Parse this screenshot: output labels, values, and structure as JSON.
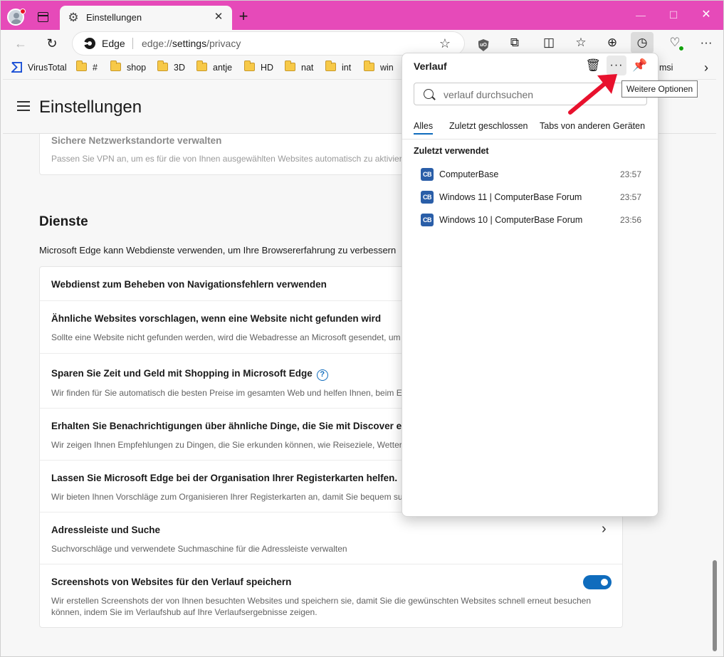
{
  "window": {
    "tab_title": "Einstellungen",
    "close_tab_glyph": "✕",
    "new_tab_glyph": "+",
    "minimize_glyph": "—",
    "maximize_glyph": "☐",
    "close_glyph": "✕",
    "titlebar_color": "#e64ab9"
  },
  "address_bar": {
    "site_label": "Edge",
    "url_scheme": "edge://",
    "url_host": "settings",
    "url_path": "/privacy"
  },
  "toolbar_icons": [
    "ublock-origin-icon",
    "extensions-icon",
    "split-screen-icon",
    "favorites-icon",
    "collections-icon",
    "history-icon",
    "browser-essentials-icon",
    "settings-and-more-icon"
  ],
  "favorites": {
    "items": [
      "VirusTotal",
      "#",
      "shop",
      "3D",
      "antje",
      "HD",
      "nat",
      "int",
      "win",
      "msi"
    ]
  },
  "settings": {
    "title": "Einstellungen",
    "top_card": {
      "title": "Sichere Netzwerkstandorte verwalten",
      "desc": "Passen Sie VPN an, um es für die von Ihnen ausgewählten Websites automatisch zu aktivieren"
    },
    "section_title": "Dienste",
    "section_desc": "Microsoft Edge kann Webdienste verwenden, um Ihre Browsererfahrung zu verbessern",
    "rows": [
      {
        "title": "Webdienst zum Beheben von Navigationsfehlern verwenden",
        "desc": ""
      },
      {
        "title": "Ähnliche Websites vorschlagen, wenn eine Website nicht gefunden wird",
        "desc": "Sollte eine Website nicht gefunden werden, wird die Webadresse an Microsoft gesendet, um"
      },
      {
        "title": "Sparen Sie Zeit und Geld mit Shopping in Microsoft Edge",
        "desc": "Wir finden für Sie automatisch die besten Preise im gesamten Web und helfen Ihnen, beim Ei"
      },
      {
        "title": "Erhalten Sie Benachrichtigungen über ähnliche Dinge, die Sie mit Discover erk",
        "desc": "Wir zeigen Ihnen Empfehlungen zu Dingen, die Sie erkunden können, wie Reiseziele, Wetter, I"
      },
      {
        "title": "Lassen Sie Microsoft Edge bei der Organisation Ihrer Registerkarten helfen.",
        "desc": "Wir bieten Ihnen Vorschläge zum Organisieren Ihrer Registerkarten an, damit Sie bequem sur"
      },
      {
        "title": "Adressleiste und Suche",
        "desc": "Suchvorschläge und verwendete Suchmaschine für die Adressleiste verwalten"
      },
      {
        "title": "Screenshots von Websites für den Verlauf speichern",
        "desc1": "Wir erstellen Screenshots der von Ihnen besuchten Websites und speichern sie, damit Sie die gewünschten Websites schnell erneut besuchen",
        "desc2": "können, indem Sie im Verlaufshub auf Ihre Verlaufsergebnisse zeigen.",
        "toggle_on": true
      }
    ]
  },
  "history": {
    "title": "Verlauf",
    "search_placeholder": "verlauf durchsuchen",
    "tabs": [
      "Alles",
      "Zuletzt geschlossen",
      "Tabs von anderen Geräten"
    ],
    "recent_heading": "Zuletzt verwendet",
    "favicon_text": "CB",
    "items": [
      {
        "title": "ComputerBase",
        "time": "23:57"
      },
      {
        "title": "Windows 11 | ComputerBase Forum",
        "time": "23:57"
      },
      {
        "title": "Windows 10 | ComputerBase Forum",
        "time": "23:56"
      }
    ],
    "more_glyph": "···",
    "tooltip": "Weitere Optionen"
  },
  "colors": {
    "accent": "#0f6cbd",
    "annotation_arrow": "#e8112d"
  }
}
